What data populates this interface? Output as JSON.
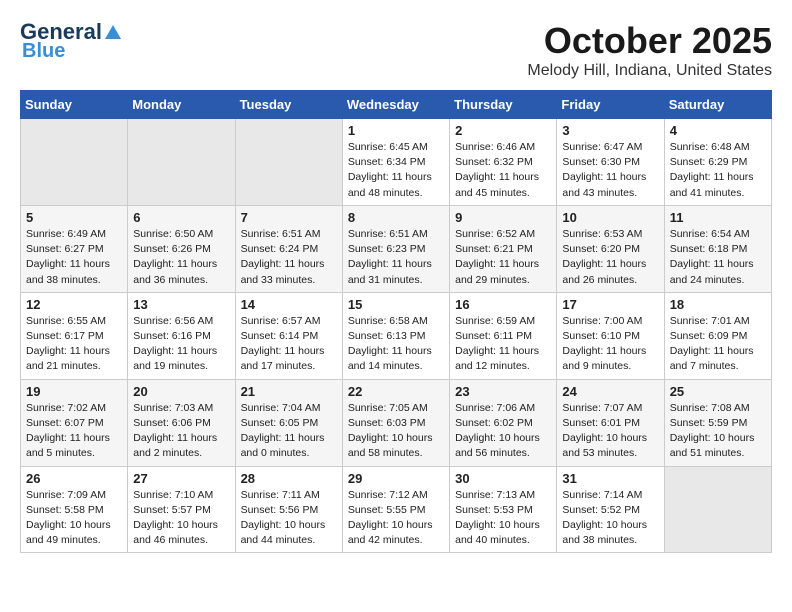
{
  "header": {
    "logo_line1": "General",
    "logo_line2": "Blue",
    "month": "October 2025",
    "location": "Melody Hill, Indiana, United States"
  },
  "days_of_week": [
    "Sunday",
    "Monday",
    "Tuesday",
    "Wednesday",
    "Thursday",
    "Friday",
    "Saturday"
  ],
  "weeks": [
    [
      {
        "day": "",
        "info": ""
      },
      {
        "day": "",
        "info": ""
      },
      {
        "day": "",
        "info": ""
      },
      {
        "day": "1",
        "info": "Sunrise: 6:45 AM\nSunset: 6:34 PM\nDaylight: 11 hours\nand 48 minutes."
      },
      {
        "day": "2",
        "info": "Sunrise: 6:46 AM\nSunset: 6:32 PM\nDaylight: 11 hours\nand 45 minutes."
      },
      {
        "day": "3",
        "info": "Sunrise: 6:47 AM\nSunset: 6:30 PM\nDaylight: 11 hours\nand 43 minutes."
      },
      {
        "day": "4",
        "info": "Sunrise: 6:48 AM\nSunset: 6:29 PM\nDaylight: 11 hours\nand 41 minutes."
      }
    ],
    [
      {
        "day": "5",
        "info": "Sunrise: 6:49 AM\nSunset: 6:27 PM\nDaylight: 11 hours\nand 38 minutes."
      },
      {
        "day": "6",
        "info": "Sunrise: 6:50 AM\nSunset: 6:26 PM\nDaylight: 11 hours\nand 36 minutes."
      },
      {
        "day": "7",
        "info": "Sunrise: 6:51 AM\nSunset: 6:24 PM\nDaylight: 11 hours\nand 33 minutes."
      },
      {
        "day": "8",
        "info": "Sunrise: 6:51 AM\nSunset: 6:23 PM\nDaylight: 11 hours\nand 31 minutes."
      },
      {
        "day": "9",
        "info": "Sunrise: 6:52 AM\nSunset: 6:21 PM\nDaylight: 11 hours\nand 29 minutes."
      },
      {
        "day": "10",
        "info": "Sunrise: 6:53 AM\nSunset: 6:20 PM\nDaylight: 11 hours\nand 26 minutes."
      },
      {
        "day": "11",
        "info": "Sunrise: 6:54 AM\nSunset: 6:18 PM\nDaylight: 11 hours\nand 24 minutes."
      }
    ],
    [
      {
        "day": "12",
        "info": "Sunrise: 6:55 AM\nSunset: 6:17 PM\nDaylight: 11 hours\nand 21 minutes."
      },
      {
        "day": "13",
        "info": "Sunrise: 6:56 AM\nSunset: 6:16 PM\nDaylight: 11 hours\nand 19 minutes."
      },
      {
        "day": "14",
        "info": "Sunrise: 6:57 AM\nSunset: 6:14 PM\nDaylight: 11 hours\nand 17 minutes."
      },
      {
        "day": "15",
        "info": "Sunrise: 6:58 AM\nSunset: 6:13 PM\nDaylight: 11 hours\nand 14 minutes."
      },
      {
        "day": "16",
        "info": "Sunrise: 6:59 AM\nSunset: 6:11 PM\nDaylight: 11 hours\nand 12 minutes."
      },
      {
        "day": "17",
        "info": "Sunrise: 7:00 AM\nSunset: 6:10 PM\nDaylight: 11 hours\nand 9 minutes."
      },
      {
        "day": "18",
        "info": "Sunrise: 7:01 AM\nSunset: 6:09 PM\nDaylight: 11 hours\nand 7 minutes."
      }
    ],
    [
      {
        "day": "19",
        "info": "Sunrise: 7:02 AM\nSunset: 6:07 PM\nDaylight: 11 hours\nand 5 minutes."
      },
      {
        "day": "20",
        "info": "Sunrise: 7:03 AM\nSunset: 6:06 PM\nDaylight: 11 hours\nand 2 minutes."
      },
      {
        "day": "21",
        "info": "Sunrise: 7:04 AM\nSunset: 6:05 PM\nDaylight: 11 hours\nand 0 minutes."
      },
      {
        "day": "22",
        "info": "Sunrise: 7:05 AM\nSunset: 6:03 PM\nDaylight: 10 hours\nand 58 minutes."
      },
      {
        "day": "23",
        "info": "Sunrise: 7:06 AM\nSunset: 6:02 PM\nDaylight: 10 hours\nand 56 minutes."
      },
      {
        "day": "24",
        "info": "Sunrise: 7:07 AM\nSunset: 6:01 PM\nDaylight: 10 hours\nand 53 minutes."
      },
      {
        "day": "25",
        "info": "Sunrise: 7:08 AM\nSunset: 5:59 PM\nDaylight: 10 hours\nand 51 minutes."
      }
    ],
    [
      {
        "day": "26",
        "info": "Sunrise: 7:09 AM\nSunset: 5:58 PM\nDaylight: 10 hours\nand 49 minutes."
      },
      {
        "day": "27",
        "info": "Sunrise: 7:10 AM\nSunset: 5:57 PM\nDaylight: 10 hours\nand 46 minutes."
      },
      {
        "day": "28",
        "info": "Sunrise: 7:11 AM\nSunset: 5:56 PM\nDaylight: 10 hours\nand 44 minutes."
      },
      {
        "day": "29",
        "info": "Sunrise: 7:12 AM\nSunset: 5:55 PM\nDaylight: 10 hours\nand 42 minutes."
      },
      {
        "day": "30",
        "info": "Sunrise: 7:13 AM\nSunset: 5:53 PM\nDaylight: 10 hours\nand 40 minutes."
      },
      {
        "day": "31",
        "info": "Sunrise: 7:14 AM\nSunset: 5:52 PM\nDaylight: 10 hours\nand 38 minutes."
      },
      {
        "day": "",
        "info": ""
      }
    ]
  ]
}
